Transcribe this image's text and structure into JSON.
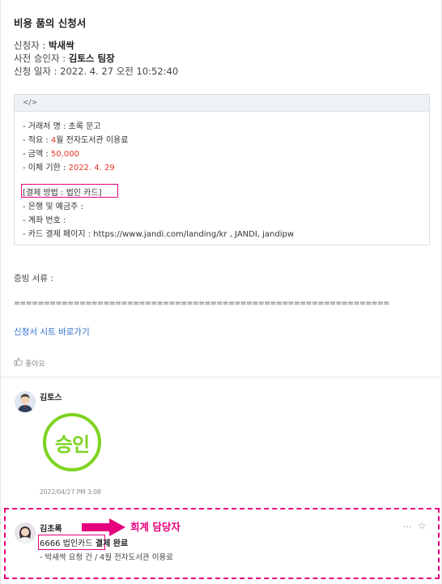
{
  "form": {
    "title": "비용 품의 신청서",
    "applicant_label": "신청자 : ",
    "applicant": "박새싹",
    "approver_label": "사전 승인자 : ",
    "approver": "김토스 팀장",
    "date_label": "신청 일자 : ",
    "date": "2022. 4. 27 오전 10:52:40"
  },
  "code": {
    "tag": "</>",
    "client_label": "- 거래처 명 : ",
    "client": "초록 문고",
    "summary_label": "- 적요 : ",
    "summary_month": "4",
    "summary_rest": "월 전자도서관 이용료",
    "amount_label": "- 금액 : ",
    "amount": "50,000",
    "due_label": "- 이체 기한 : ",
    "due": "2022. 4. 29",
    "payment_method": "[결제 방법 : 법인 카드]",
    "bank": "- 은행 및 예금주 :",
    "account": "- 계좌 번호 :",
    "card_page": "- 카드 결제 페이지 : https://www.jandi.com/landing/kr , JANDI, jandipw"
  },
  "evidence_label": "증빙 서류 :",
  "separator": "===============================================================",
  "sheet_link": "신청서 시트 바로가기",
  "like_label": "좋아요",
  "messages": [
    {
      "sender": "김토스",
      "stamp_text": "승인",
      "timestamp": "2022/04/27 PM 3:08"
    },
    {
      "sender": "김초록",
      "card_text": "6666 법인카드",
      "status_text": " 결제 완료",
      "detail": "- 박새싹 요청 건 / 4월 전자도서관 이용료",
      "more_icon": "···",
      "star_icon": "☆"
    }
  ],
  "annotation": "회계 담당자",
  "colors": {
    "highlight": "#e6007e",
    "stamp_green": "#7ed321",
    "link_blue": "#2e6bcf",
    "value_red": "#e8342a"
  }
}
